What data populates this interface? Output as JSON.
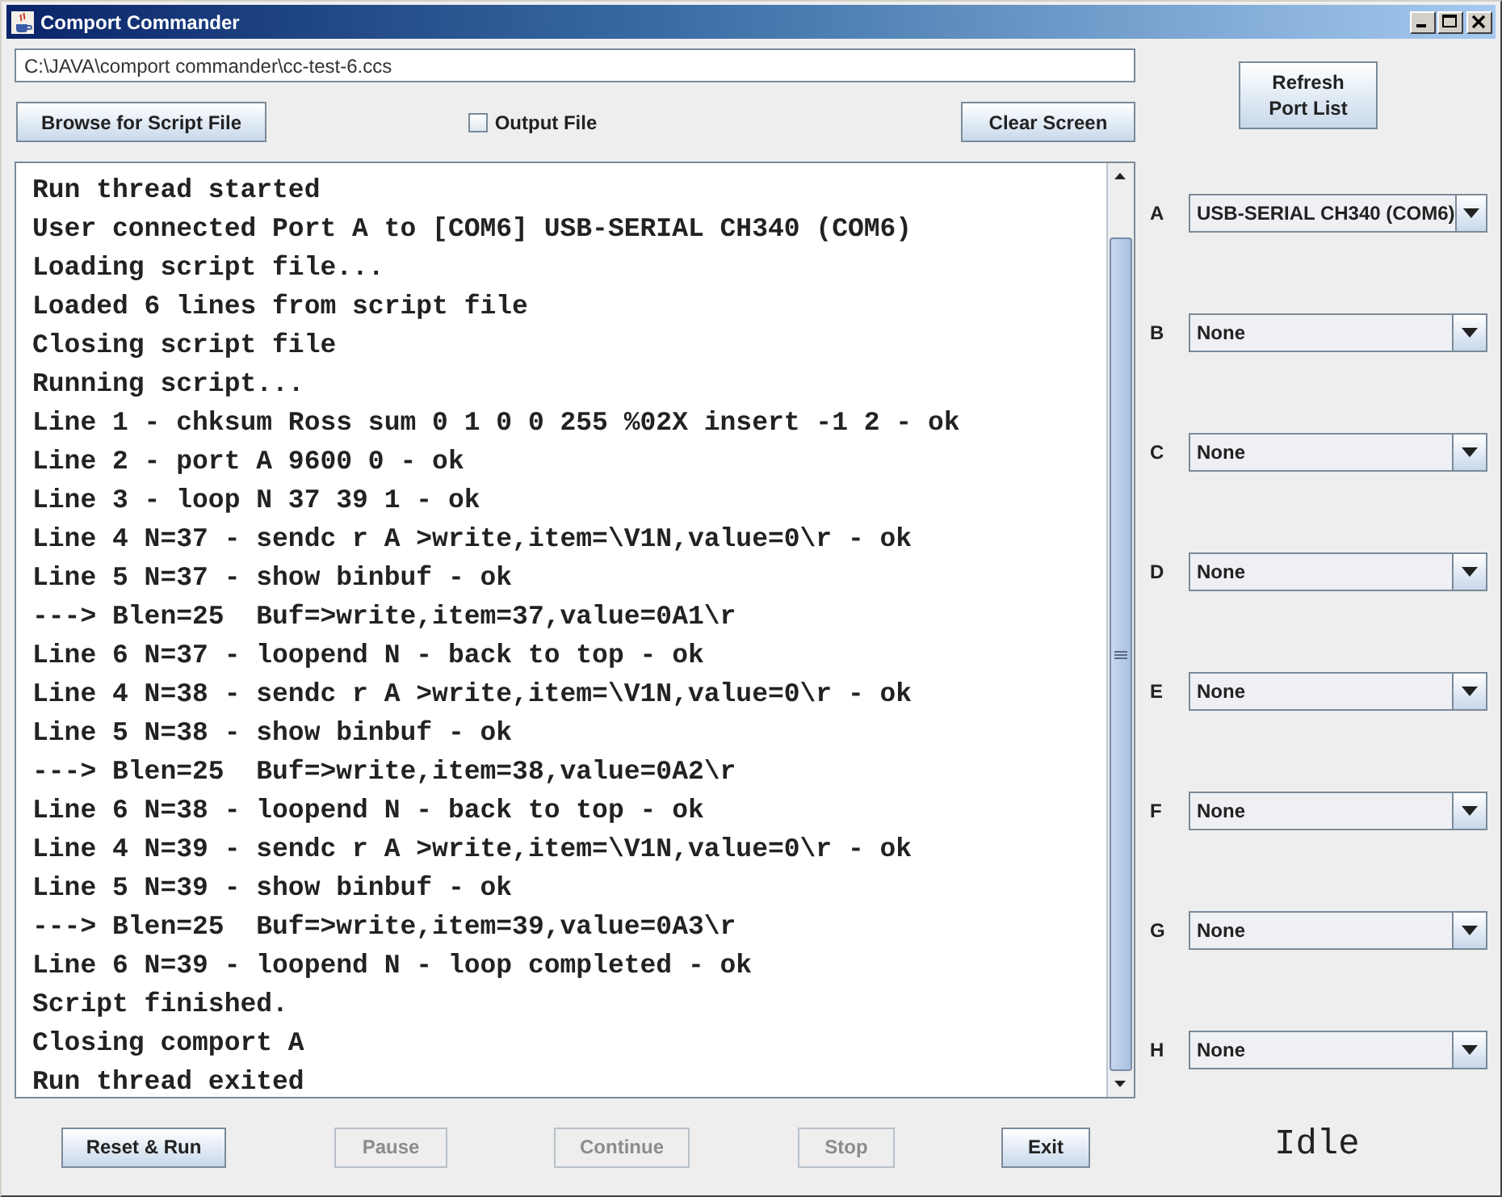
{
  "window": {
    "title": "Comport Commander"
  },
  "script_path": {
    "value": "C:\\JAVA\\comport commander\\cc-test-6.ccs"
  },
  "browse_button": {
    "label": "Browse for Script File"
  },
  "output_file": {
    "label": "Output File",
    "checked": false
  },
  "clear_button": {
    "label": "Clear Screen"
  },
  "refresh_button": {
    "label": "Refresh Port List"
  },
  "log": {
    "lines": [
      "Run thread started",
      "User connected Port A to [COM6] USB-SERIAL CH340 (COM6)",
      "Loading script file...",
      "Loaded 6 lines from script file",
      "Closing script file",
      "Running script...",
      "Line 1 - chksum Ross sum 0 1 0 0 255 %02X insert -1 2 - ok",
      "Line 2 - port A 9600 0 - ok",
      "Line 3 - loop N 37 39 1 - ok",
      "Line 4 N=37 - sendc r A >write,item=\\V1N,value=0\\r - ok",
      "Line 5 N=37 - show binbuf - ok",
      "---> Blen=25  Buf=>write,item=37,value=0A1\\r",
      "Line 6 N=37 - loopend N - back to top - ok",
      "Line 4 N=38 - sendc r A >write,item=\\V1N,value=0\\r - ok",
      "Line 5 N=38 - show binbuf - ok",
      "---> Blen=25  Buf=>write,item=38,value=0A2\\r",
      "Line 6 N=38 - loopend N - back to top - ok",
      "Line 4 N=39 - sendc r A >write,item=\\V1N,value=0\\r - ok",
      "Line 5 N=39 - show binbuf - ok",
      "---> Blen=25  Buf=>write,item=39,value=0A3\\r",
      "Line 6 N=39 - loopend N - loop completed - ok",
      "Script finished.",
      "Closing comport A",
      "Run thread exited"
    ]
  },
  "ports": [
    {
      "label": "A",
      "value": "USB-SERIAL CH340 (COM6)"
    },
    {
      "label": "B",
      "value": "None"
    },
    {
      "label": "C",
      "value": "None"
    },
    {
      "label": "D",
      "value": "None"
    },
    {
      "label": "E",
      "value": "None"
    },
    {
      "label": "F",
      "value": "None"
    },
    {
      "label": "G",
      "value": "None"
    },
    {
      "label": "H",
      "value": "None"
    }
  ],
  "controls": [
    {
      "label": "Reset & Run",
      "disabled": false
    },
    {
      "label": "Pause",
      "disabled": true
    },
    {
      "label": "Continue",
      "disabled": true
    },
    {
      "label": "Stop",
      "disabled": true
    },
    {
      "label": "Exit",
      "disabled": false
    }
  ],
  "status": "Idle"
}
